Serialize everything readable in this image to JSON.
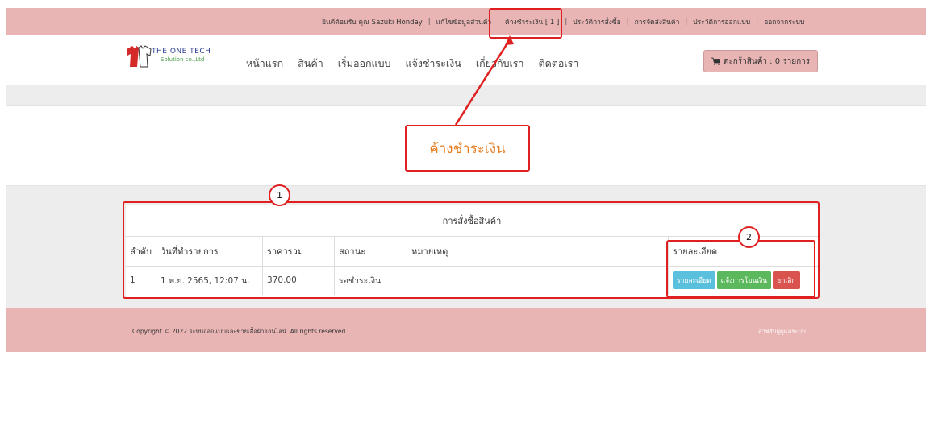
{
  "topbar": {
    "welcome": "ยินดีต้อนรับ คุณ Sazuki Honday",
    "edit_profile": "แก้ไขข้อมูลส่วนตัว",
    "pending_payment": "ค้างชำระเงิน [ 1 ]",
    "order_history": "ประวัติการสั่งซื้อ",
    "shipping": "การจัดส่งสินค้า",
    "design_history": "ประวัติการออกแบบ",
    "logout": "ออกจากระบบ",
    "separator": "|"
  },
  "logo": {
    "line1": "THE ONE TECH",
    "line2": "Solution co.,Ltd"
  },
  "nav": {
    "home": "หน้าแรก",
    "products": "สินค้า",
    "start_design": "เริ่มออกแบบ",
    "notify_payment": "แจ้งชำระเงิน",
    "about": "เกี่ยวกับเรา",
    "contact": "ติดต่อเรา"
  },
  "cart": {
    "label": "ตะกร้าสินค้า : 0 รายการ"
  },
  "hero": {
    "title": "ค้างชำระเงิน"
  },
  "annotations": {
    "marker1": "1",
    "marker2": "2"
  },
  "orders": {
    "title": "การสั่งซื้อสินค้า",
    "headers": [
      "ลำดับ",
      "วันที่ทำรายการ",
      "ราคารวม",
      "สถานะ",
      "หมายเหตุ",
      "รายละเอียด"
    ],
    "rows": [
      {
        "no": "1",
        "date": "1 พ.ย. 2565, 12:07 น.",
        "total": "370.00",
        "status": "รอชำระเงิน",
        "note": "",
        "btn_detail": "รายละเอียด",
        "btn_transfer": "แจ้งการโอนเงิน",
        "btn_cancel": "ยกเลิก"
      }
    ]
  },
  "footer": {
    "copyright_symbol": "©",
    "copyright": "Copyright © 2022 ระบบออกแบบและขายเสื้อผ้าออนไลน์. All rights reserved.",
    "admin": "สำหรับผู้ดูแลระบบ"
  },
  "colors": {
    "topbar": "#e8b4b4",
    "highlight": "#e02020",
    "hero_text": "#e67e22",
    "btn_info": "#5bc0de",
    "btn_success": "#5cb85c",
    "btn_danger": "#d9534f"
  }
}
